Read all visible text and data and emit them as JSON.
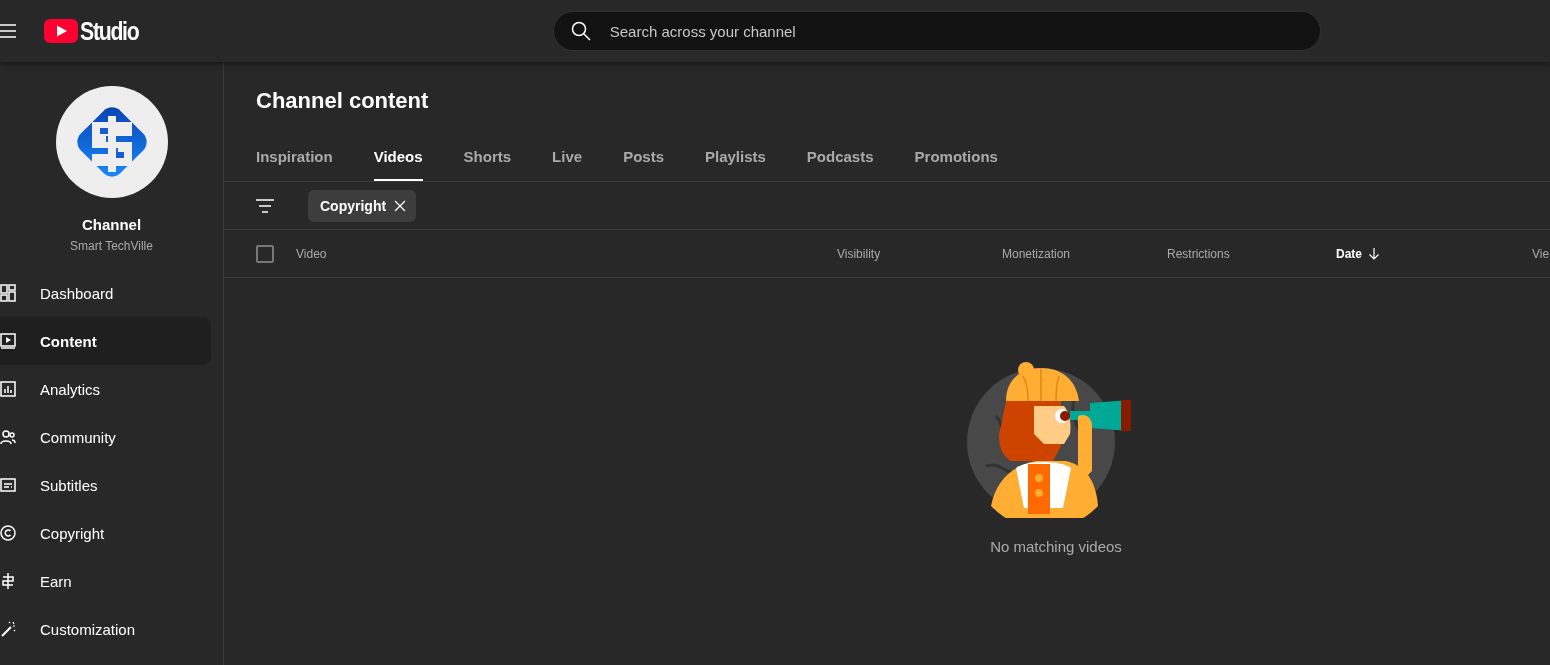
{
  "header": {
    "logo_text": "Studio",
    "search": {
      "placeholder": "Search across your channel"
    }
  },
  "sidebar": {
    "channel_label": "Channel",
    "channel_name": "Smart TechVille",
    "items": [
      {
        "label": "Dashboard",
        "kind": "dashboard",
        "selected": false
      },
      {
        "label": "Content",
        "kind": "content",
        "selected": true
      },
      {
        "label": "Analytics",
        "kind": "analytics",
        "selected": false
      },
      {
        "label": "Community",
        "kind": "community",
        "selected": false
      },
      {
        "label": "Subtitles",
        "kind": "subtitles",
        "selected": false
      },
      {
        "label": "Copyright",
        "kind": "copyright",
        "selected": false
      },
      {
        "label": "Earn",
        "kind": "earn",
        "selected": false
      },
      {
        "label": "Customization",
        "kind": "customization",
        "selected": false
      }
    ]
  },
  "page_title": "Channel content",
  "tabs": [
    {
      "label": "Inspiration",
      "selected": false
    },
    {
      "label": "Videos",
      "selected": true
    },
    {
      "label": "Shorts",
      "selected": false
    },
    {
      "label": "Live",
      "selected": false
    },
    {
      "label": "Posts",
      "selected": false
    },
    {
      "label": "Playlists",
      "selected": false
    },
    {
      "label": "Podcasts",
      "selected": false
    },
    {
      "label": "Promotions",
      "selected": false
    }
  ],
  "filters": [
    {
      "label": "Copyright"
    }
  ],
  "table": {
    "select_all_checked": false,
    "columns": [
      {
        "label": "Video",
        "sorted": false
      },
      {
        "label": "Visibility",
        "sorted": false
      },
      {
        "label": "Monetization",
        "sorted": false
      },
      {
        "label": "Restrictions",
        "sorted": false
      },
      {
        "label": "Date",
        "sorted": true
      },
      {
        "label": "Vie",
        "sorted": false
      }
    ]
  },
  "empty_state": {
    "message": "No matching videos"
  }
}
